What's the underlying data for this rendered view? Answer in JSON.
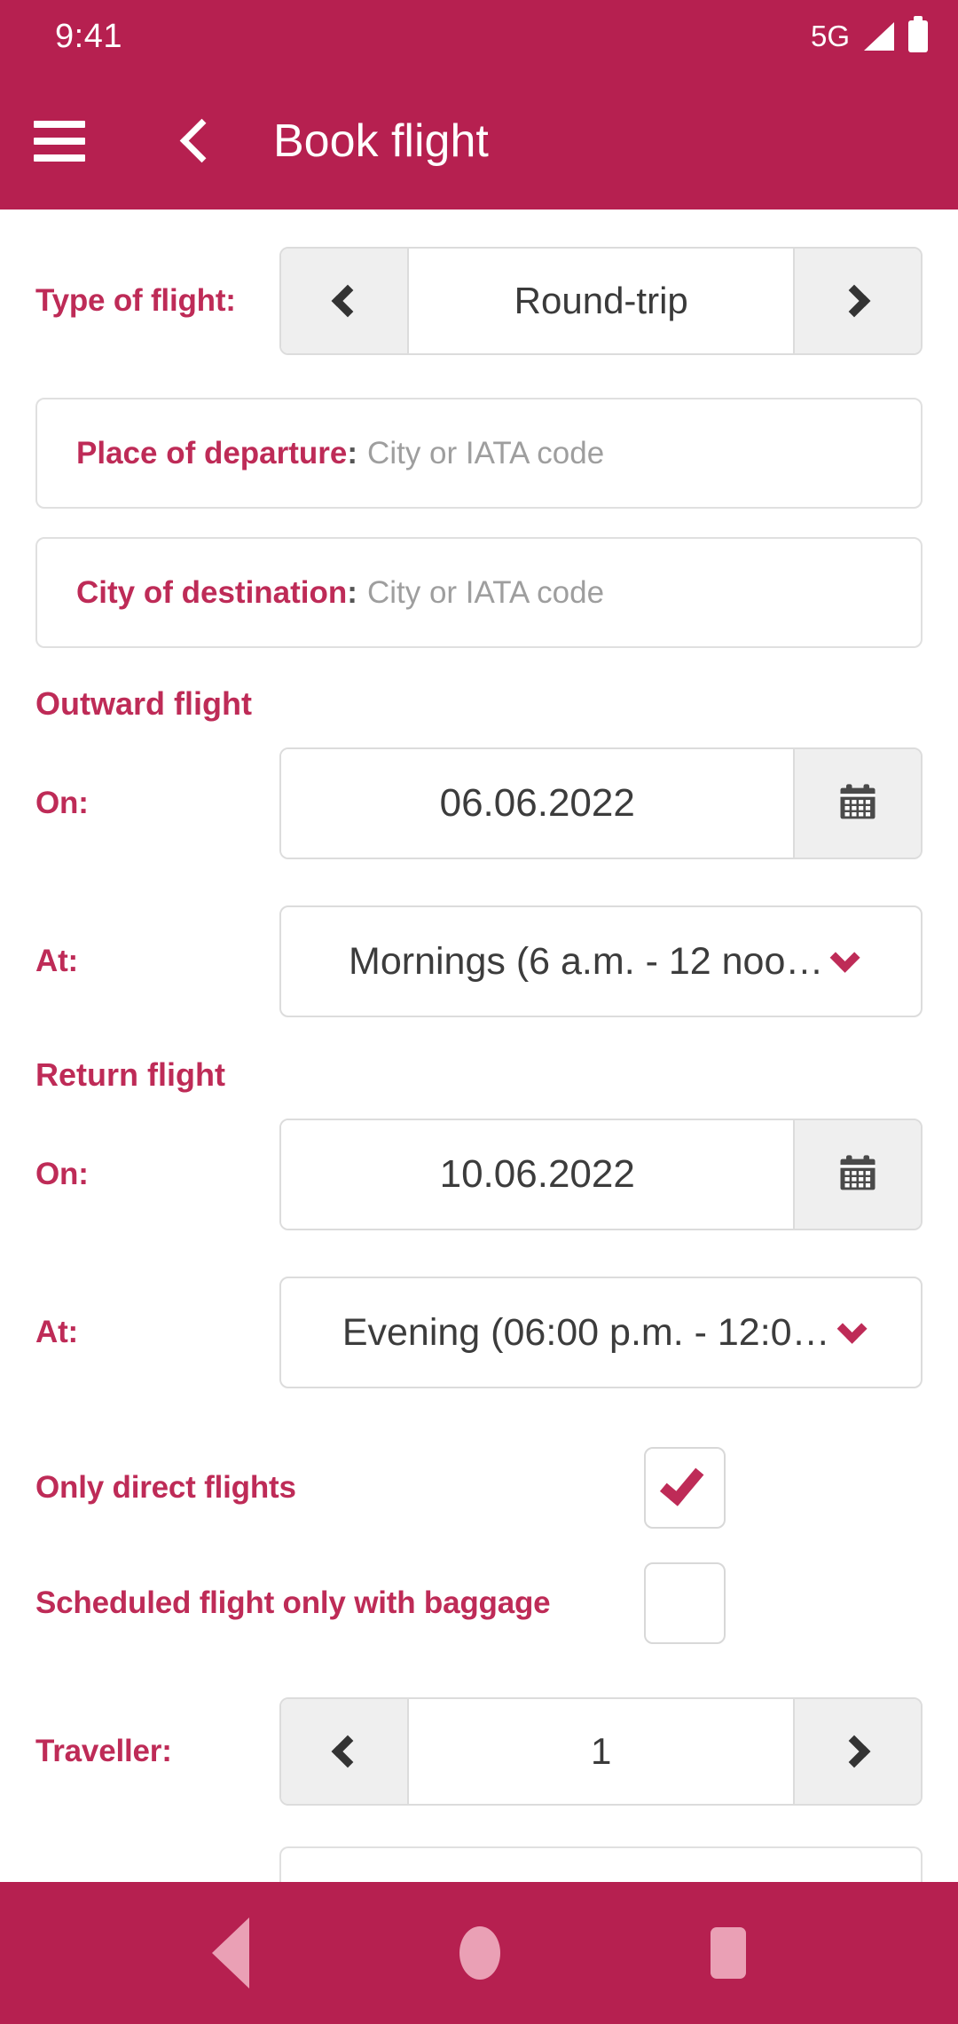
{
  "status_bar": {
    "time": "9:41",
    "network": "5G",
    "signal_icon": "signal-bars-icon",
    "battery_icon": "battery-full-icon"
  },
  "app_bar": {
    "menu_icon": "hamburger-menu-icon",
    "back_icon": "back-chevron-icon",
    "title": "Book flight"
  },
  "theme": {
    "primary": "#B62050",
    "label": "#BE2B57",
    "value_text": "#3c3c3c",
    "field_border": "#dcdcdc",
    "button_fill": "#efefef",
    "nav_icon": "#EAA0B5",
    "placeholder": "#9e9e9e"
  },
  "form": {
    "flight_type": {
      "label": "Type of flight:",
      "value": "Round-trip",
      "prev_icon": "chevron-left-icon",
      "next_icon": "chevron-right-icon"
    },
    "departure": {
      "label": "Place of departure",
      "separator": ":",
      "placeholder": "City or IATA code",
      "value": ""
    },
    "destination": {
      "label": "City of destination",
      "separator": ":",
      "placeholder": "City or IATA code",
      "value": ""
    },
    "outward": {
      "section_title": "Outward flight",
      "date_label": "On:",
      "date_value": "06.06.2022",
      "calendar_icon": "calendar-icon",
      "time_label": "At:",
      "time_value": "Mornings (6 a.m. - 12 noo…",
      "caret_icon": "chevron-down-icon"
    },
    "return": {
      "section_title": "Return flight",
      "date_label": "On:",
      "date_value": "10.06.2022",
      "calendar_icon": "calendar-icon",
      "time_label": "At:",
      "time_value": "Evening (06:00 p.m. - 12:0…",
      "caret_icon": "chevron-down-icon"
    },
    "direct_flights": {
      "label": "Only direct flights",
      "checked": true,
      "check_icon": "check-mark-icon"
    },
    "with_baggage": {
      "label": "Scheduled flight only with baggage",
      "checked": false
    },
    "traveller": {
      "label": "Traveller:",
      "value": "1",
      "prev_icon": "chevron-left-icon",
      "next_icon": "chevron-right-icon"
    }
  },
  "nav_bar": {
    "back_icon": "nav-back-triangle-icon",
    "home_icon": "nav-home-circle-icon",
    "recents_icon": "nav-recents-square-icon"
  }
}
